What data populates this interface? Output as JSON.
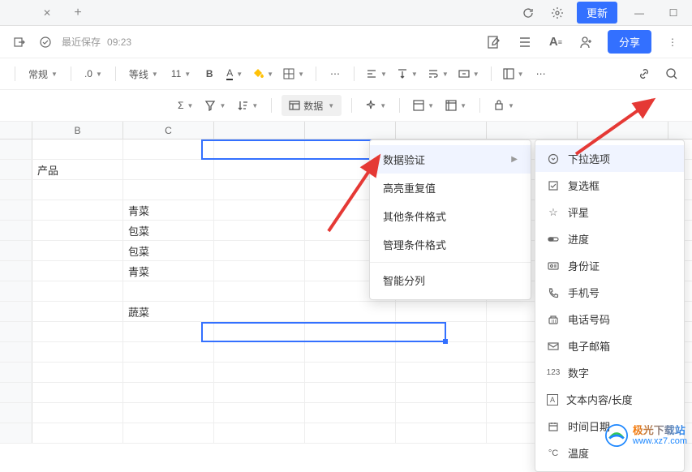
{
  "tabbar": {
    "update": "更新"
  },
  "secondbar": {
    "save_label": "最近保存",
    "save_time": "09:23",
    "share": "分享"
  },
  "toolbar": {
    "format": "常规",
    "decimals": ".0",
    "border_style": "等线",
    "font_size": "11",
    "data_label": "数据"
  },
  "columns": [
    "B",
    "C"
  ],
  "cells": {
    "b_r2": "产品",
    "c_r4": "青菜",
    "c_r5": "包菜",
    "c_r6": "包菜",
    "c_r7": "青菜",
    "c_r9": "蔬菜"
  },
  "menu1": {
    "validate": "数据验证",
    "highlight": "高亮重复值",
    "other_cond": "其他条件格式",
    "manage_cond": "管理条件格式",
    "smart_split": "智能分列"
  },
  "menu2": {
    "dropdown": "下拉选项",
    "checkbox": "复选框",
    "rating": "评星",
    "progress": "进度",
    "idcard": "身份证",
    "phone": "手机号",
    "tel": "电话号码",
    "email": "电子邮箱",
    "number": "数字",
    "textlen": "文本内容/长度",
    "datetime": "时间日期",
    "temperature": "温度",
    "num_label": "123",
    "text_label": "A"
  },
  "watermark": {
    "cn": "极光下载站",
    "url": "www.xz7.com"
  }
}
